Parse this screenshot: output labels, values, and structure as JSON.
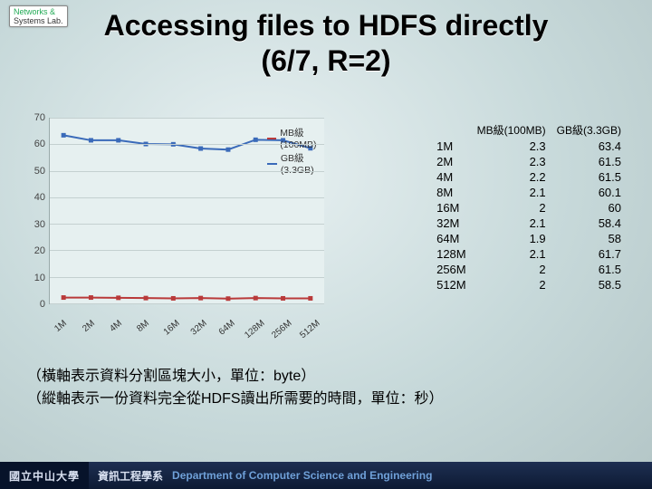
{
  "logo": {
    "line1": "Networks &",
    "line2": "Systems Lab."
  },
  "title": {
    "line1": "Accessing files to HDFS directly",
    "line2": "(6/7, R=2)"
  },
  "chart_data": {
    "type": "line",
    "categories": [
      "1M",
      "2M",
      "4M",
      "8M",
      "16M",
      "32M",
      "64M",
      "128M",
      "256M",
      "512M"
    ],
    "series": [
      {
        "name": "MB級(100MB)",
        "color": "#b93a3a",
        "values": [
          2.3,
          2.3,
          2.2,
          2.1,
          2,
          2.1,
          1.9,
          2.1,
          2,
          2
        ]
      },
      {
        "name": "GB級(3.3GB)",
        "color": "#3a6ab9",
        "values": [
          63.4,
          61.5,
          61.5,
          60.1,
          60,
          58.4,
          58,
          61.7,
          61.5,
          58.5
        ]
      }
    ],
    "ylim": [
      0,
      70
    ],
    "yticks": [
      0,
      10,
      20,
      30,
      40,
      50,
      60,
      70
    ]
  },
  "table": {
    "headers": [
      "",
      "MB級(100MB)",
      "GB級(3.3GB)"
    ],
    "rows": [
      [
        "1M",
        "2.3",
        "63.4"
      ],
      [
        "2M",
        "2.3",
        "61.5"
      ],
      [
        "4M",
        "2.2",
        "61.5"
      ],
      [
        "8M",
        "2.1",
        "60.1"
      ],
      [
        "16M",
        "2",
        "60"
      ],
      [
        "32M",
        "2.1",
        "58.4"
      ],
      [
        "64M",
        "1.9",
        "58"
      ],
      [
        "128M",
        "2.1",
        "61.7"
      ],
      [
        "256M",
        "2",
        "61.5"
      ],
      [
        "512M",
        "2",
        "58.5"
      ]
    ]
  },
  "notes": {
    "line1": "（橫軸表示資料分割區塊大小，單位：byte）",
    "line2": "（縱軸表示一份資料完全從HDFS讀出所需要的時間，單位：秒）"
  },
  "footer": {
    "uni": "國立中山大學",
    "dept_zh": "資訊工程學系",
    "dept_en": "Department of Computer Science and Engineering"
  }
}
